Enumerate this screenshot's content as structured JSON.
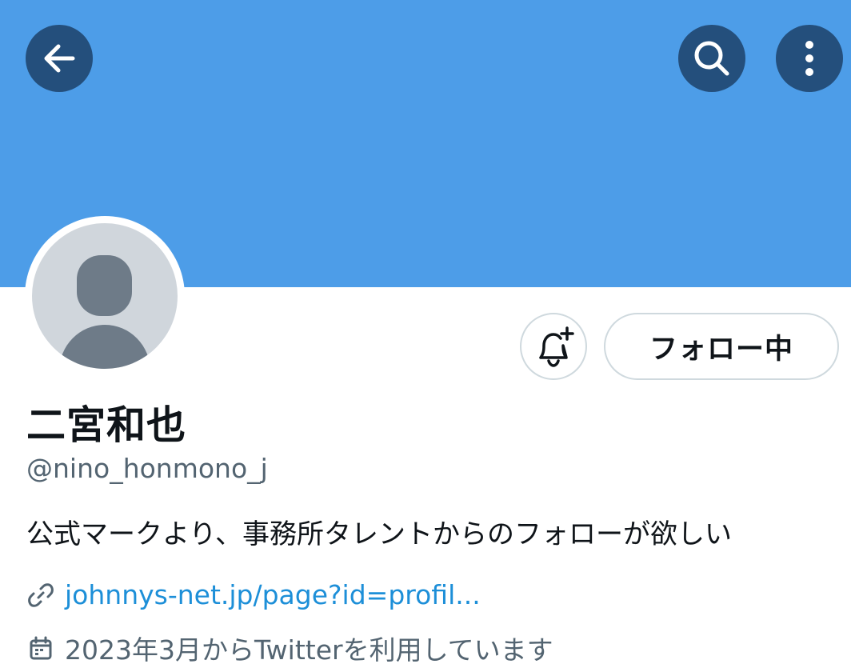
{
  "header": {
    "back_icon": "arrow-left-icon",
    "search_icon": "search-icon",
    "more_icon": "more-vertical-icon"
  },
  "colors": {
    "banner": "#4d9de8",
    "header_button": "#244f7c",
    "link": "#1d8fd8",
    "secondary_text": "#536471"
  },
  "profile": {
    "display_name": "二宮和也",
    "handle": "@nino_honmono_j",
    "bio": "公式マークより、事務所タレントからのフォローが欲しい",
    "website": "johnnys-net.jp/page?id=profil...",
    "joined": "2023年3月からTwitterを利用しています"
  },
  "actions": {
    "notify_icon": "bell-plus-icon",
    "following_label": "フォロー中"
  }
}
